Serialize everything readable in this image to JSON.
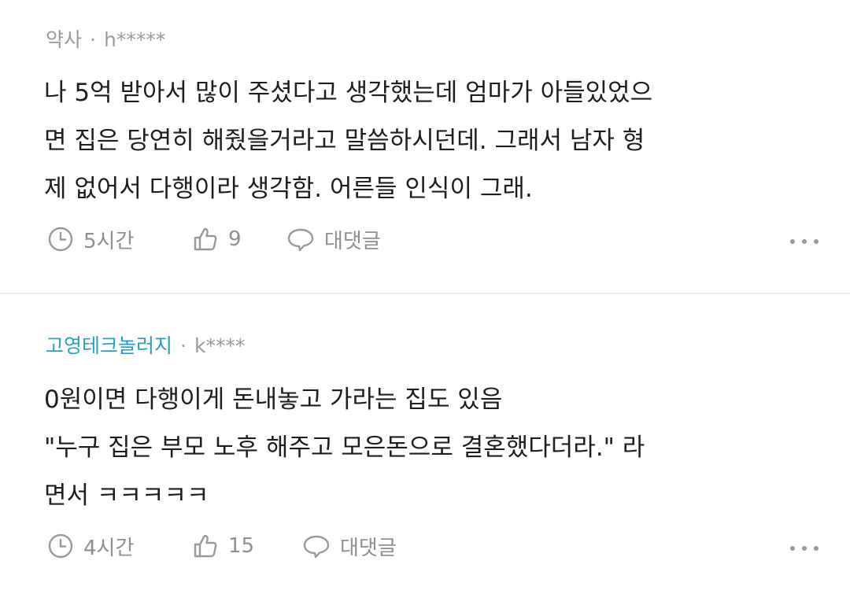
{
  "comments": [
    {
      "badge": "약사",
      "separator": "·",
      "author": "h*****",
      "body": "나 5억 받아서 많이 주셨다고 생각했는데 엄마가 아들있었으\n면 집은 당연히 해줬을거라고 말씀하시던데. 그래서 남자 형\n제 없어서 다행이라 생각함. 어른들 인식이 그래.",
      "time": "5시간",
      "likes": "9",
      "reply_label": "대댓글"
    },
    {
      "badge": "고영테크놀러지",
      "separator": "·",
      "author": "k****",
      "body": "0원이면 다행이게 돈내놓고 가라는 집도 있음\n\"누구 집은 부모 노후 해주고 모은돈으로 결혼했다더라.\" 라\n면서 ㅋㅋㅋㅋㅋ",
      "time": "4시간",
      "likes": "15",
      "reply_label": "대댓글"
    }
  ],
  "colors": {
    "badge_default": "#9a9a9a",
    "badge_company": "#29a0c2",
    "body_text": "#1e1e1e",
    "meta_text": "#9a9a9a"
  },
  "icons": [
    "clock-icon",
    "thumbs-up-icon",
    "speech-bubble-icon",
    "more-options-icon"
  ]
}
